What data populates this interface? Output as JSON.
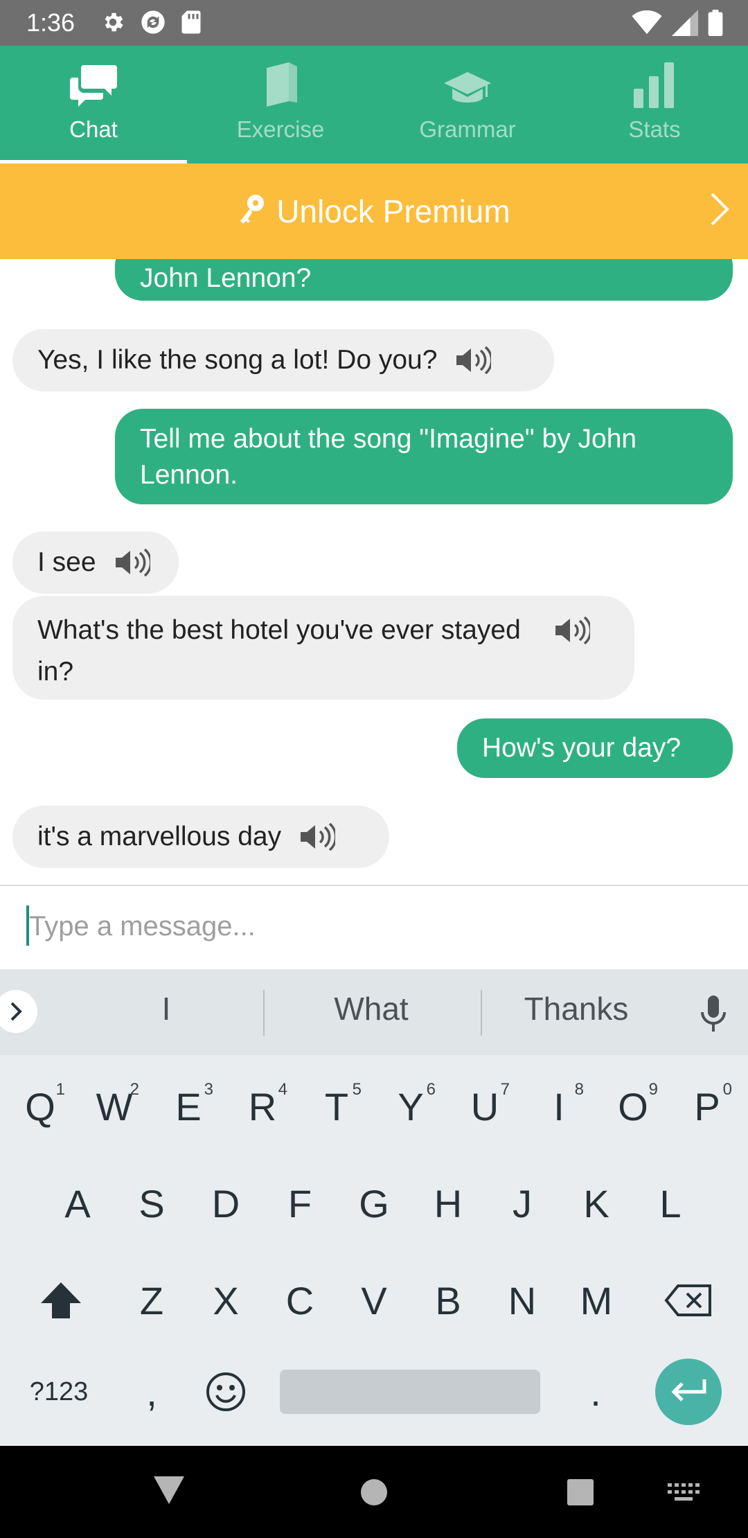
{
  "status_bar": {
    "time": "1:36"
  },
  "tabs": [
    {
      "label": "Chat",
      "icon": "chat-icon",
      "active": true
    },
    {
      "label": "Exercise",
      "icon": "book-icon",
      "active": false
    },
    {
      "label": "Grammar",
      "icon": "graduation-cap-icon",
      "active": false
    },
    {
      "label": "Stats",
      "icon": "bar-chart-icon",
      "active": false
    }
  ],
  "premium": {
    "label": "Unlock Premium"
  },
  "messages": [
    {
      "from": "user",
      "text": "John Lennon?"
    },
    {
      "from": "bot",
      "text": "Yes, I like the song a lot! Do you?"
    },
    {
      "from": "user",
      "text": "Tell me about the song \"Imagine\" by John Lennon."
    },
    {
      "from": "bot",
      "text": "I see"
    },
    {
      "from": "bot",
      "text": "What's the best hotel you've ever stayed in?"
    },
    {
      "from": "user",
      "text": "How's your day?"
    },
    {
      "from": "bot",
      "text": "it's a marvellous day"
    }
  ],
  "input": {
    "placeholder": "Type a message..."
  },
  "keyboard": {
    "suggestions": [
      "I",
      "What",
      "Thanks"
    ],
    "row1": [
      "Q",
      "W",
      "E",
      "R",
      "T",
      "Y",
      "U",
      "I",
      "O",
      "P"
    ],
    "row1_hints": [
      "1",
      "2",
      "3",
      "4",
      "5",
      "6",
      "7",
      "8",
      "9",
      "0"
    ],
    "row2": [
      "A",
      "S",
      "D",
      "F",
      "G",
      "H",
      "J",
      "K",
      "L"
    ],
    "row3": [
      "Z",
      "X",
      "C",
      "V",
      "B",
      "N",
      "M"
    ],
    "symbols_key": "?123",
    "comma_key": ",",
    "period_key": "."
  }
}
